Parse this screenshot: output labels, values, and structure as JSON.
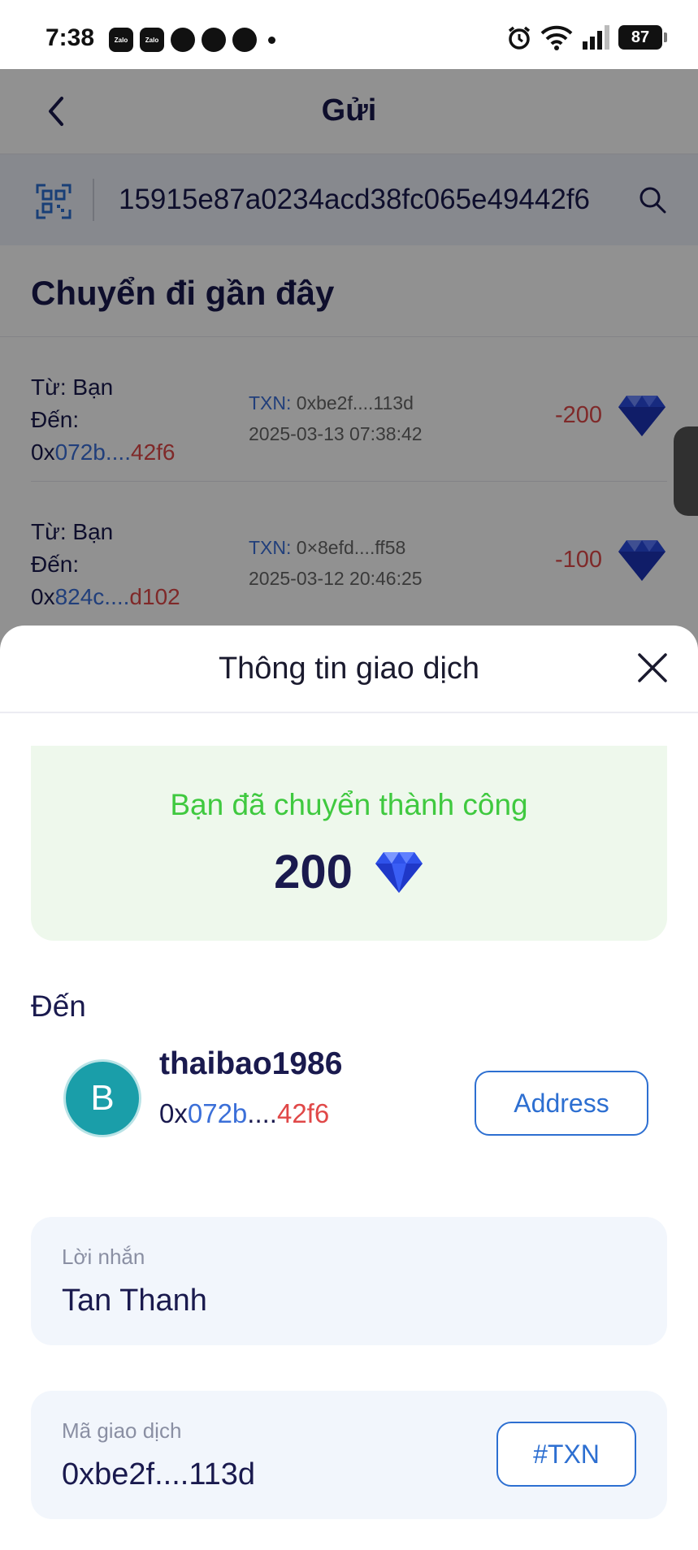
{
  "status_bar": {
    "time": "7:38",
    "app_icons": [
      "Zalo",
      "Zalo",
      "chat-bubble-icon",
      "messenger-icon",
      "messenger-icon"
    ],
    "battery": "87"
  },
  "header": {
    "title": "Gửi"
  },
  "search": {
    "value": "15915e87a0234acd38fc065e49442f6"
  },
  "recent": {
    "title": "Chuyển đi gần đây",
    "items": [
      {
        "from": "Từ: Bạn",
        "to_label": "Đến:",
        "addr_prefix": "0x",
        "addr_blue": "072b",
        "addr_dots": "....",
        "addr_red": "42f6",
        "txn_label": "TXN:",
        "txn": "0xbe2f....113d",
        "time": "2025-03-13 07:38:42",
        "amount": "-200"
      },
      {
        "from": "Từ: Bạn",
        "to_label": "Đến:",
        "addr_prefix": "0x",
        "addr_blue": "824c",
        "addr_dots": "....",
        "addr_red": "d102",
        "txn_label": "TXN:",
        "txn": "0×8efd....ff58",
        "time": "2025-03-12 20:46:25",
        "amount": "-100"
      }
    ]
  },
  "sheet": {
    "title": "Thông tin giao dịch",
    "success_text": "Bạn đã chuyển thành công",
    "amount": "200",
    "to_label": "Đến",
    "recipient": {
      "avatar_letter": "B",
      "name": "thaibao1986",
      "addr_prefix": "0x",
      "addr_blue": "072b",
      "addr_dots": "....",
      "addr_red": "42f6",
      "button": "Address"
    },
    "message": {
      "label": "Lời nhắn",
      "value": "Tan Thanh"
    },
    "transaction": {
      "label": "Mã giao dịch",
      "value": "0xbe2f....113d",
      "button": "#TXN"
    }
  },
  "colors": {
    "accent_blue": "#2d6fd1",
    "success_green": "#3fc93f",
    "negative_red": "#e04848",
    "navy_text": "#1a1a4e",
    "avatar_teal": "#1a9ea9"
  }
}
